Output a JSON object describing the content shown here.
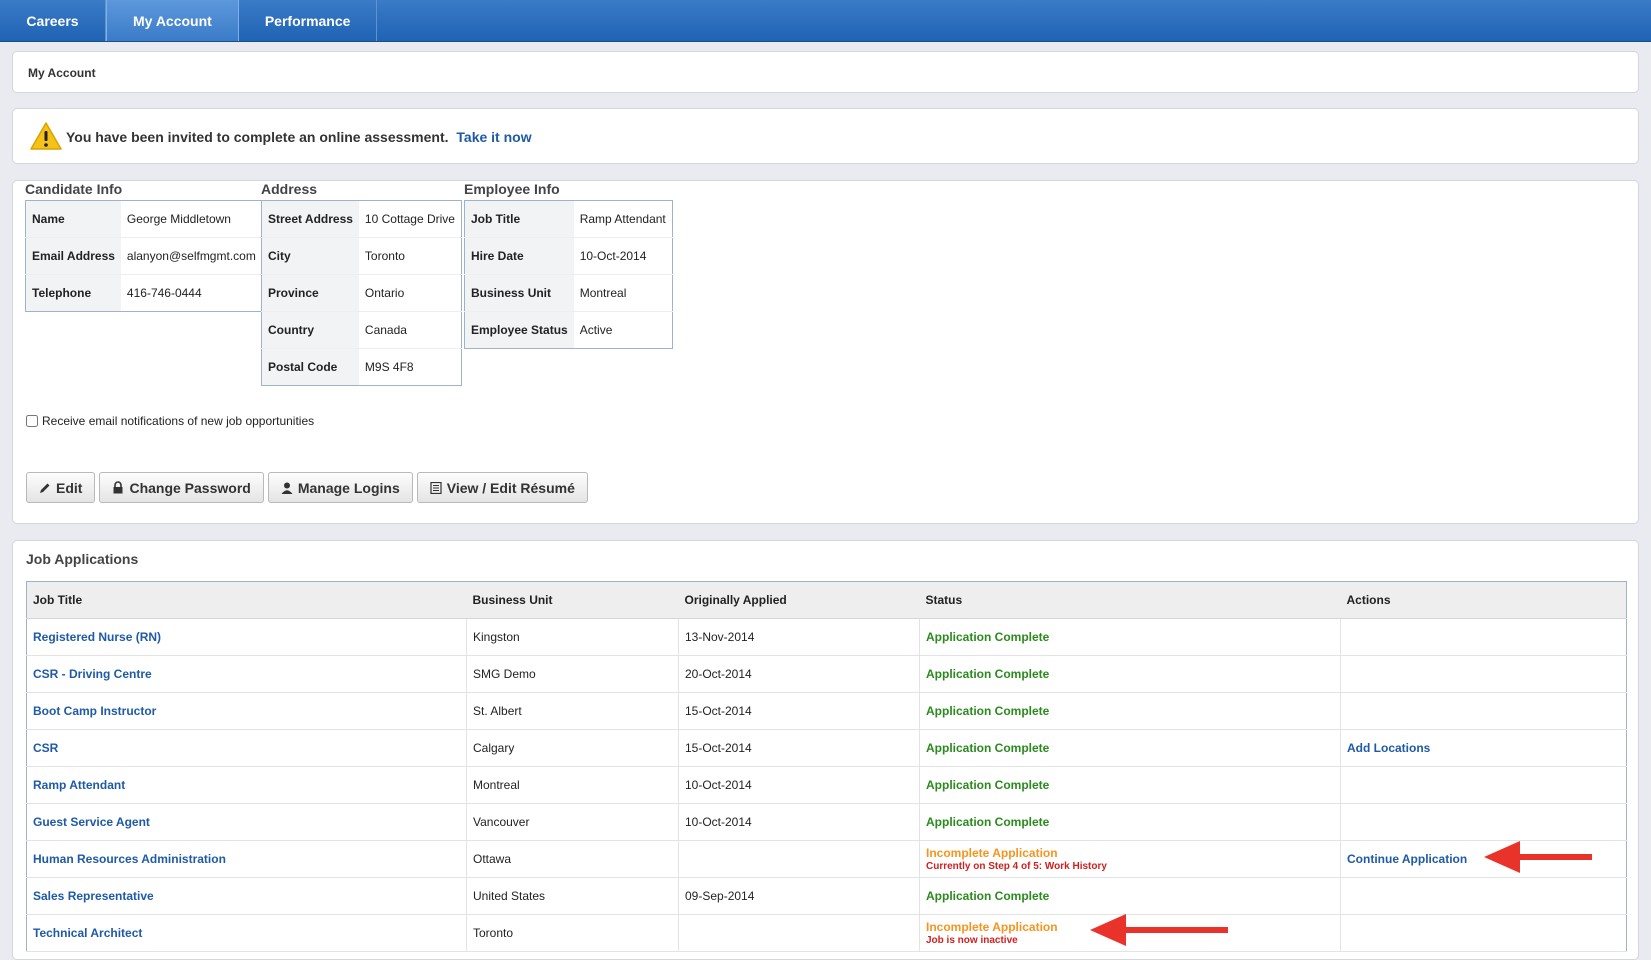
{
  "nav": {
    "tabs": [
      {
        "label": "Careers"
      },
      {
        "label": "My Account"
      },
      {
        "label": "Performance"
      }
    ]
  },
  "breadcrumb": {
    "current": "My Account"
  },
  "notice": {
    "message": "You have been invited to complete an online assessment.",
    "link": "Take it now"
  },
  "candidate": {
    "title": "Candidate Info",
    "rows": [
      {
        "label": "Name",
        "value": "George Middletown"
      },
      {
        "label": "Email Address",
        "value": "alanyon@selfmgmt.com"
      },
      {
        "label": "Telephone",
        "value": "416-746-0444"
      }
    ]
  },
  "address": {
    "title": "Address",
    "rows": [
      {
        "label": "Street Address",
        "value": "10 Cottage Drive"
      },
      {
        "label": "City",
        "value": "Toronto"
      },
      {
        "label": "Province",
        "value": "Ontario"
      },
      {
        "label": "Country",
        "value": "Canada"
      },
      {
        "label": "Postal Code",
        "value": "M9S 4F8"
      }
    ]
  },
  "employee": {
    "title": "Employee Info",
    "rows": [
      {
        "label": "Job Title",
        "value": "Ramp Attendant"
      },
      {
        "label": "Hire Date",
        "value": "10-Oct-2014"
      },
      {
        "label": "Business Unit",
        "value": "Montreal"
      },
      {
        "label": "Employee Status",
        "value": "Active"
      }
    ]
  },
  "notifications": {
    "label": "Receive email notifications of new job opportunities"
  },
  "buttons": {
    "edit": "Edit",
    "change_password": "Change Password",
    "manage_logins": "Manage Logins",
    "view_resume": "View / Edit Résumé"
  },
  "jobs": {
    "title": "Job Applications",
    "headers": {
      "job_title": "Job Title",
      "business_unit": "Business Unit",
      "applied": "Originally Applied",
      "status": "Status",
      "actions": "Actions"
    },
    "rows": [
      {
        "title": "Registered Nurse (RN)",
        "unit": "Kingston",
        "applied": "13-Nov-2014",
        "status": "Application Complete",
        "status_note": "",
        "action": ""
      },
      {
        "title": "CSR - Driving Centre",
        "unit": "SMG Demo",
        "applied": "20-Oct-2014",
        "status": "Application Complete",
        "status_note": "",
        "action": ""
      },
      {
        "title": "Boot Camp Instructor",
        "unit": "St. Albert",
        "applied": "15-Oct-2014",
        "status": "Application Complete",
        "status_note": "",
        "action": ""
      },
      {
        "title": "CSR",
        "unit": "Calgary",
        "applied": "15-Oct-2014",
        "status": "Application Complete",
        "status_note": "",
        "action": "Add Locations"
      },
      {
        "title": "Ramp Attendant",
        "unit": "Montreal",
        "applied": "10-Oct-2014",
        "status": "Application Complete",
        "status_note": "",
        "action": ""
      },
      {
        "title": "Guest Service Agent",
        "unit": "Vancouver",
        "applied": "10-Oct-2014",
        "status": "Application Complete",
        "status_note": "",
        "action": ""
      },
      {
        "title": "Human Resources Administration",
        "unit": "Ottawa",
        "applied": "",
        "status": "Incomplete Application",
        "status_note": "Currently on Step 4 of 5: Work History",
        "action": "Continue Application"
      },
      {
        "title": "Sales Representative",
        "unit": "United States",
        "applied": "09-Sep-2014",
        "status": "Application Complete",
        "status_note": "",
        "action": ""
      },
      {
        "title": "Technical Architect",
        "unit": "Toronto",
        "applied": "",
        "status": "Incomplete Application",
        "status_note": "Job is now inactive",
        "action": ""
      }
    ]
  },
  "colors": {
    "nav": "#2a6fbf",
    "link": "#1f5aa6",
    "complete": "#2b8a1e",
    "incomplete": "#f5951f",
    "note": "#d12020",
    "annotation_arrow": "#e8322a"
  }
}
